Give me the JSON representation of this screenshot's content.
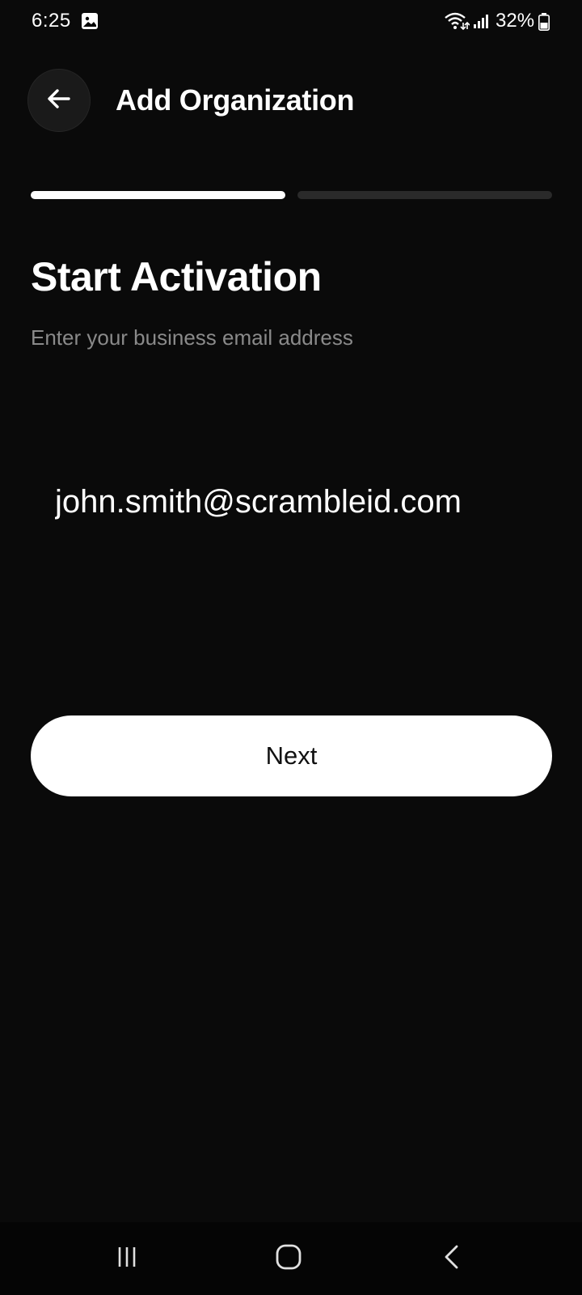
{
  "status_bar": {
    "time": "6:25",
    "battery": "32%",
    "icons": [
      "gallery-icon",
      "wifi-icon",
      "signal-icon",
      "battery-icon"
    ]
  },
  "header": {
    "title": "Add Organization",
    "back_icon": "arrow-left-icon"
  },
  "progress": {
    "current_step": 1,
    "total_steps": 2
  },
  "content": {
    "title": "Start Activation",
    "subtitle": "Enter your business email address",
    "email_value": "john.smith@scrambleid.com"
  },
  "actions": {
    "next_label": "Next"
  },
  "nav_bar": {
    "icons": [
      "recent-apps-icon",
      "home-icon",
      "back-icon"
    ]
  },
  "colors": {
    "background": "#0a0a0a",
    "primary_button": "#ffffff",
    "subtitle_text": "#8a8a8a",
    "progress_inactive": "#2a2a2a"
  }
}
